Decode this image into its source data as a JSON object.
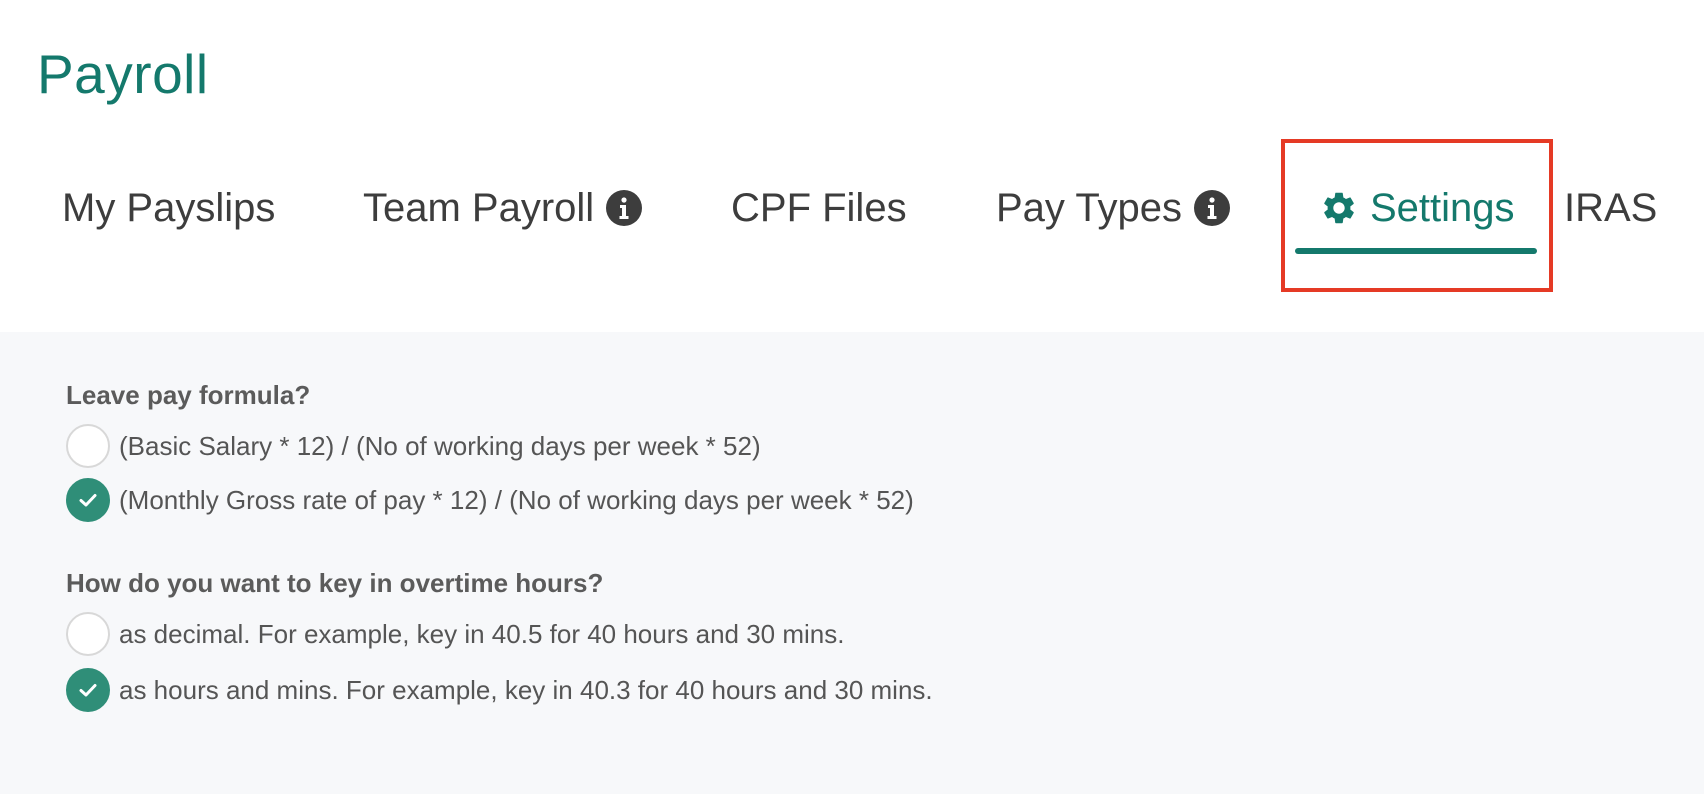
{
  "page": {
    "title": "Payroll"
  },
  "tabs": [
    {
      "label": "My Payslips",
      "icon": null,
      "active": false
    },
    {
      "label": "Team Payroll",
      "icon": "info-icon",
      "active": false
    },
    {
      "label": "CPF Files",
      "icon": null,
      "active": false
    },
    {
      "label": "Pay Types",
      "icon": "info-icon",
      "active": false
    },
    {
      "label": "Settings",
      "icon": "gear-icon",
      "active": true
    },
    {
      "label": "IRAS",
      "icon": null,
      "active": false
    }
  ],
  "settings": {
    "leave_pay": {
      "question": "Leave pay formula?",
      "options": [
        {
          "label": "(Basic Salary * 12) / (No of working days per week * 52)",
          "checked": false
        },
        {
          "label": "(Monthly Gross rate of pay * 12) / (No of working days per week * 52)",
          "checked": true
        }
      ]
    },
    "overtime": {
      "question": "How do you want to key in overtime hours?",
      "options": [
        {
          "label": "as decimal. For example, key in 40.5 for 40 hours and 30 mins.",
          "checked": false
        },
        {
          "label": "as hours and mins. For example, key in 40.3 for 40 hours and 30 mins.",
          "checked": true
        }
      ]
    }
  },
  "colors": {
    "accent": "#14796c",
    "radio_checked": "#2f8e78",
    "highlight": "#e53a25",
    "panel_bg": "#f7f8fa"
  }
}
